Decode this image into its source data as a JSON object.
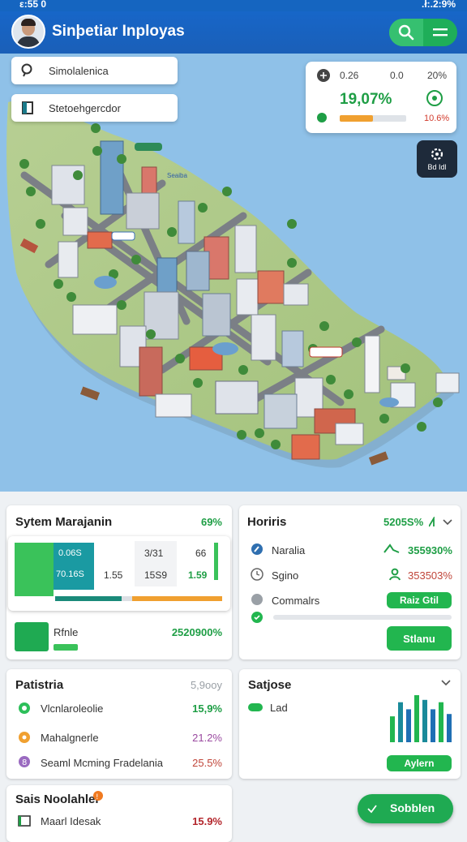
{
  "status": {
    "time": "ε:55 0",
    "right": ".ł:.2:9%"
  },
  "app": {
    "title": "Sinþetiar Inployas"
  },
  "search": [
    {
      "label": "Simolalenica"
    },
    {
      "label": "Stetoehgercdor"
    }
  ],
  "stats_overlay": {
    "v1": "0.26",
    "v2": "0.0",
    "v3": "20%",
    "big": "19,07%",
    "red": "10.6%",
    "progress": 0.5
  },
  "map_button": {
    "label": "Bd Idl"
  },
  "map_labels": {
    "a": "Seaiba"
  },
  "system": {
    "title": "Sytem Marajanin",
    "pct": "69%",
    "inner": {
      "l1": "0.06S",
      "l2": "70.16S",
      "c1": "1.55",
      "m1": "3/31",
      "m2": "15S9",
      "r1": "66",
      "r2": "1.59"
    },
    "bar_progress": 0.4,
    "sub_label": "Rfnle",
    "sub_value": "2520900%"
  },
  "horiris": {
    "title": "Horiris",
    "value": "5205S%",
    "rows": [
      {
        "label": "Naralia",
        "value": "355930%"
      },
      {
        "label": "Sgino",
        "value": "353503%"
      },
      {
        "label": "Commalrs",
        "value": "Raiz Gtil"
      }
    ],
    "button": "Stlanu"
  },
  "patistria": {
    "title": "Patistria",
    "pct": "5,9ooy",
    "rows": [
      {
        "label": "Vlcnlaroleolie",
        "value": "15,9%"
      },
      {
        "label": "Mahalgnerle",
        "value": "21.2%"
      },
      {
        "label": "Seaml Mcming Fradelania",
        "value": "25.5%"
      }
    ]
  },
  "satjose": {
    "title": "Satjose",
    "legend": "Lad",
    "button": "Aylern",
    "bars": [
      0.55,
      0.85,
      0.7,
      1.0,
      0.9,
      0.7,
      0.85,
      0.6
    ]
  },
  "bottom": {
    "title": "Sais Noolahler",
    "row_label": "Maarl Idesak",
    "row_value": "15.9%"
  },
  "fab": {
    "label": "Sobblen"
  }
}
